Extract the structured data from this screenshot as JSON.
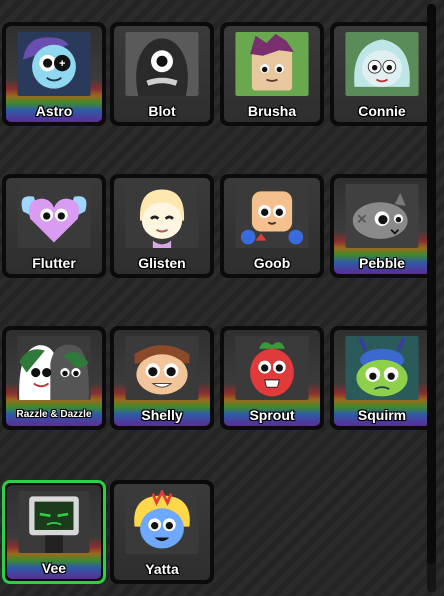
{
  "characters": [
    {
      "name": "Astro",
      "state": "available",
      "background": "rainbow",
      "accent": "#7fd1ff",
      "icon": "astro-portrait-icon"
    },
    {
      "name": "Blot",
      "state": "available",
      "background": "dark",
      "accent": "#3a3a3a",
      "icon": "blot-portrait-icon"
    },
    {
      "name": "Brusha",
      "state": "available",
      "background": "dark",
      "accent": "#e6c49a",
      "icon": "brusha-portrait-icon"
    },
    {
      "name": "Connie",
      "state": "available",
      "background": "dark",
      "accent": "#bfe6e6",
      "icon": "connie-portrait-icon"
    },
    {
      "name": "Flutter",
      "state": "available",
      "background": "dark",
      "accent": "#d99cf2",
      "icon": "flutter-portrait-icon"
    },
    {
      "name": "Glisten",
      "state": "available",
      "background": "dark",
      "accent": "#ffe8b0",
      "icon": "glisten-portrait-icon"
    },
    {
      "name": "Goob",
      "state": "available",
      "background": "dark",
      "accent": "#f4c08e",
      "icon": "goob-portrait-icon"
    },
    {
      "name": "Pebble",
      "state": "available",
      "background": "rainbow",
      "accent": "#8a8a8a",
      "icon": "pebble-portrait-icon"
    },
    {
      "name": "Razzle & Dazzle",
      "state": "available",
      "background": "rainbow",
      "accent": "#ffffff",
      "icon": "razzle-dazzle-portrait-icon"
    },
    {
      "name": "Shelly",
      "state": "available",
      "background": "rainbow",
      "accent": "#f2c49a",
      "icon": "shelly-portrait-icon"
    },
    {
      "name": "Sprout",
      "state": "available",
      "background": "rainbow",
      "accent": "#e03a3a",
      "icon": "sprout-portrait-icon"
    },
    {
      "name": "Squirm",
      "state": "available",
      "background": "rainbow",
      "accent": "#8fd04a",
      "icon": "squirm-portrait-icon"
    },
    {
      "name": "Vee",
      "state": "selected",
      "background": "rainbow",
      "accent": "#2fcf45",
      "icon": "vee-portrait-icon"
    },
    {
      "name": "Yatta",
      "state": "available",
      "background": "dark",
      "accent": "#6ea8ff",
      "icon": "yatta-portrait-icon"
    }
  ],
  "colors": {
    "selected_border": "#2fcf45",
    "card_frame": "#0b0b0b"
  }
}
